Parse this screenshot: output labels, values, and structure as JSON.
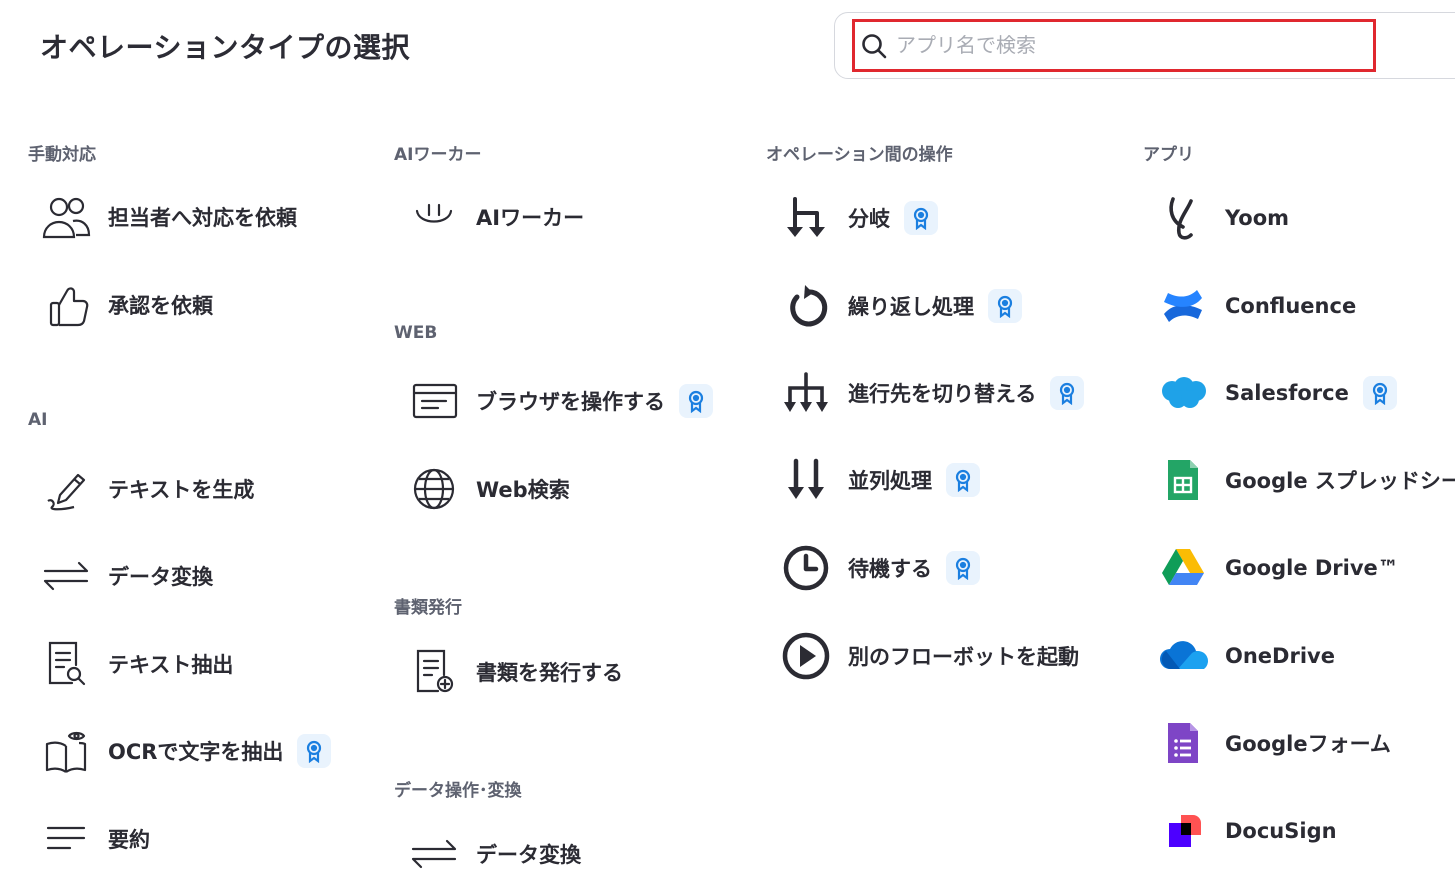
{
  "header": {
    "title": "オペレーションタイプの選択"
  },
  "search": {
    "placeholder": "アプリ名で検索",
    "value": ""
  },
  "columns": [
    {
      "sections": [
        {
          "label": "手動対応",
          "items": [
            {
              "label": "担当者へ対応を依頼",
              "icon": "users-icon",
              "premium": false
            },
            {
              "label": "承認を依頼",
              "icon": "thumbs-up-icon",
              "premium": false
            }
          ]
        },
        {
          "label": "AI",
          "items": [
            {
              "label": "テキストを生成",
              "icon": "pen-icon",
              "premium": false
            },
            {
              "label": "データ変換",
              "icon": "swap-arrows-icon",
              "premium": false
            },
            {
              "label": "テキスト抽出",
              "icon": "document-search-icon",
              "premium": false
            },
            {
              "label": "OCRで文字を抽出",
              "icon": "book-eye-icon",
              "premium": true
            },
            {
              "label": "要約",
              "icon": "lines-icon",
              "premium": false
            }
          ]
        }
      ]
    },
    {
      "sections": [
        {
          "label": "AIワーカー",
          "items": [
            {
              "label": "AIワーカー",
              "icon": "smile-icon",
              "premium": false
            }
          ]
        },
        {
          "label": "WEB",
          "items": [
            {
              "label": "ブラウザを操作する",
              "icon": "browser-window-icon",
              "premium": true
            },
            {
              "label": "Web検索",
              "icon": "globe-icon",
              "premium": false
            }
          ]
        },
        {
          "label": "書類発行",
          "items": [
            {
              "label": "書類を発行する",
              "icon": "document-add-icon",
              "premium": false
            }
          ]
        },
        {
          "label": "データ操作･変換",
          "items": [
            {
              "label": "データ変換",
              "icon": "swap-arrows-icon",
              "premium": false
            }
          ]
        }
      ]
    },
    {
      "sections": [
        {
          "label": "オペレーション間の操作",
          "items": [
            {
              "label": "分岐",
              "icon": "branch-icon",
              "premium": true
            },
            {
              "label": "繰り返し処理",
              "icon": "loop-icon",
              "premium": true
            },
            {
              "label": "進行先を切り替える",
              "icon": "switch-route-icon",
              "premium": true
            },
            {
              "label": "並列処理",
              "icon": "parallel-icon",
              "premium": true
            },
            {
              "label": "待機する",
              "icon": "clock-icon",
              "premium": true
            },
            {
              "label": "別のフローボットを起動",
              "icon": "play-circle-icon",
              "premium": false
            }
          ]
        }
      ]
    },
    {
      "sections": [
        {
          "label": "アプリ",
          "items": [
            {
              "label": "Yoom",
              "icon": "yoom-logo-icon",
              "premium": false
            },
            {
              "label": "Confluence",
              "icon": "confluence-logo-icon",
              "premium": false
            },
            {
              "label": "Salesforce",
              "icon": "salesforce-logo-icon",
              "premium": true
            },
            {
              "label": "Google スプレッドシート",
              "icon": "google-sheets-logo-icon",
              "premium": false
            },
            {
              "label": "Google Drive™",
              "icon": "google-drive-logo-icon",
              "premium": false
            },
            {
              "label": "OneDrive",
              "icon": "onedrive-logo-icon",
              "premium": false
            },
            {
              "label": "Googleフォーム",
              "icon": "google-forms-logo-icon",
              "premium": false
            },
            {
              "label": "DocuSign",
              "icon": "docusign-logo-icon",
              "premium": false
            }
          ]
        }
      ]
    }
  ],
  "colors": {
    "accent_badge_bg": "#e9f3fd",
    "accent_badge_fg": "#1b7fe0",
    "highlight": "#e0282f"
  }
}
